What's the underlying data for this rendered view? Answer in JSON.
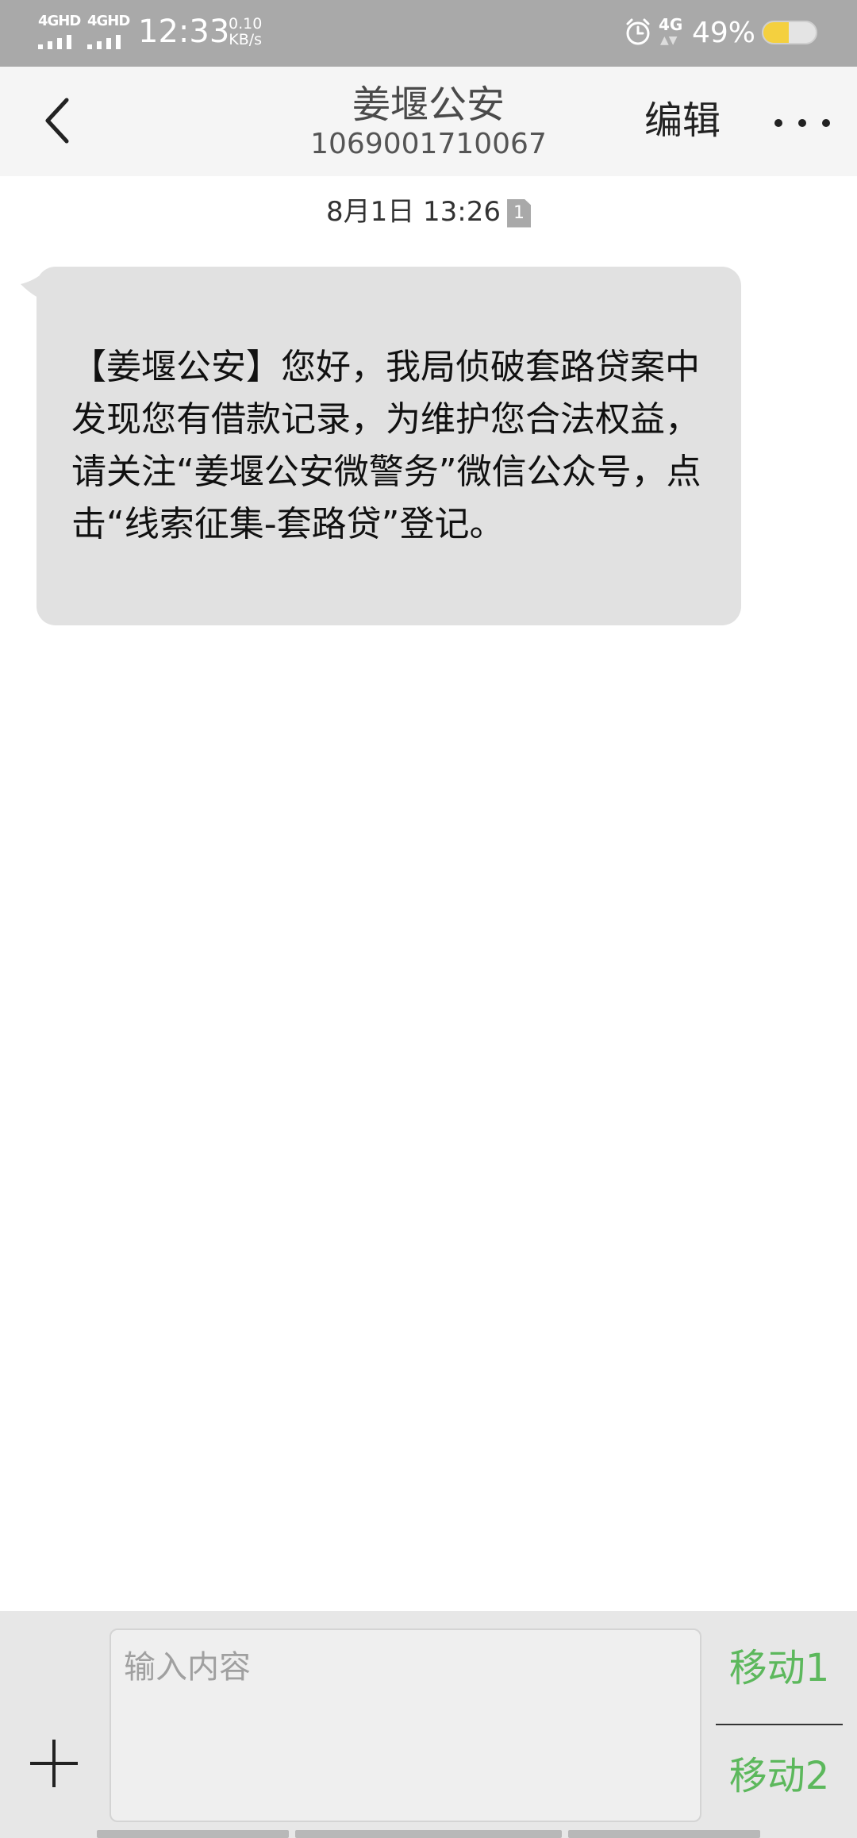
{
  "status_bar": {
    "sim1_network": "4GHD",
    "sim2_network": "4GHD",
    "time": "12:33",
    "net_speed_value": "0.10",
    "net_speed_unit": "KB/s",
    "alarm_icon": "alarm-clock-icon",
    "data_network": "4G",
    "battery_percent": "49%",
    "battery_level": 0.49,
    "battery_color": "#f4d03f"
  },
  "header": {
    "back_icon": "chevron-left-icon",
    "title": "姜堰公安",
    "subtitle": "1069001710067",
    "edit_label": "编辑",
    "more_icon": "more-horizontal-icon"
  },
  "conversation": {
    "timestamp": "8月1日 13:26",
    "sim_badge": "1",
    "message": "【姜堰公安】您好，我局侦破套路贷案中发现您有借款记录，为维护您合法权益，请关注“姜堰公安微警务”微信公众号，点击“线索征集-套路贷”登记。",
    "bubble_color": "#e1e1e1"
  },
  "composer": {
    "add_icon": "plus-icon",
    "placeholder": "输入内容",
    "send_sim1_label": "移动1",
    "send_sim2_label": "移动2",
    "accent_color": "#5cb85c"
  }
}
